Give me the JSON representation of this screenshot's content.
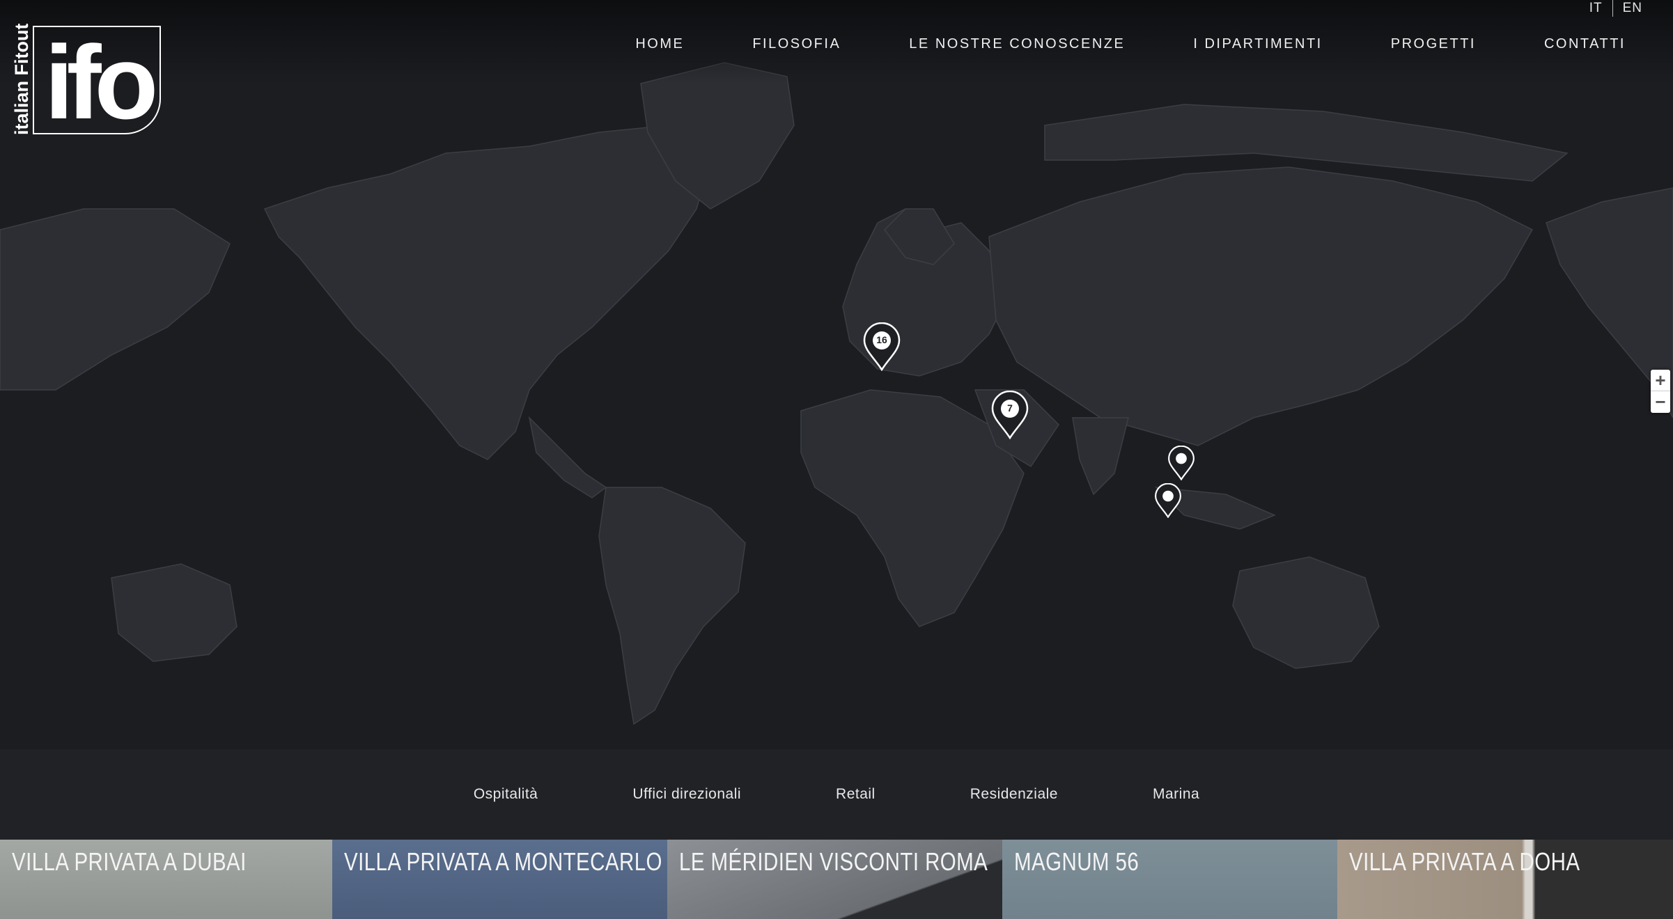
{
  "logo": {
    "wordmark": "ifo",
    "tagline": "italian Fitout"
  },
  "languages": [
    "IT",
    "EN"
  ],
  "nav": [
    "HOME",
    "FILOSOFIA",
    "LE NOSTRE CONOSCENZE",
    "I DIPARTIMENTI",
    "PROGETTI",
    "CONTATTI"
  ],
  "map": {
    "markers": [
      {
        "label": "16",
        "type": "cluster"
      },
      {
        "label": "7",
        "type": "cluster"
      },
      {
        "label": "",
        "type": "single"
      },
      {
        "label": "",
        "type": "single"
      }
    ],
    "zoom": {
      "in": "+",
      "out": "−"
    }
  },
  "categories": [
    "Ospitalità",
    "Uffici direzionali",
    "Retail",
    "Residenziale",
    "Marina"
  ],
  "projects": [
    {
      "title": "VILLA PRIVATA A DUBAI"
    },
    {
      "title": "VILLA PRIVATA A MONTECARLO"
    },
    {
      "title": "LE MÉRIDIEN VISCONTI ROMA"
    },
    {
      "title": "MAGNUM 56"
    },
    {
      "title": "VILLA PRIVATA A DOHA"
    }
  ],
  "colors": {
    "background": "#1c1d21",
    "land": "#2c2e33",
    "accent": "#ffffff"
  }
}
